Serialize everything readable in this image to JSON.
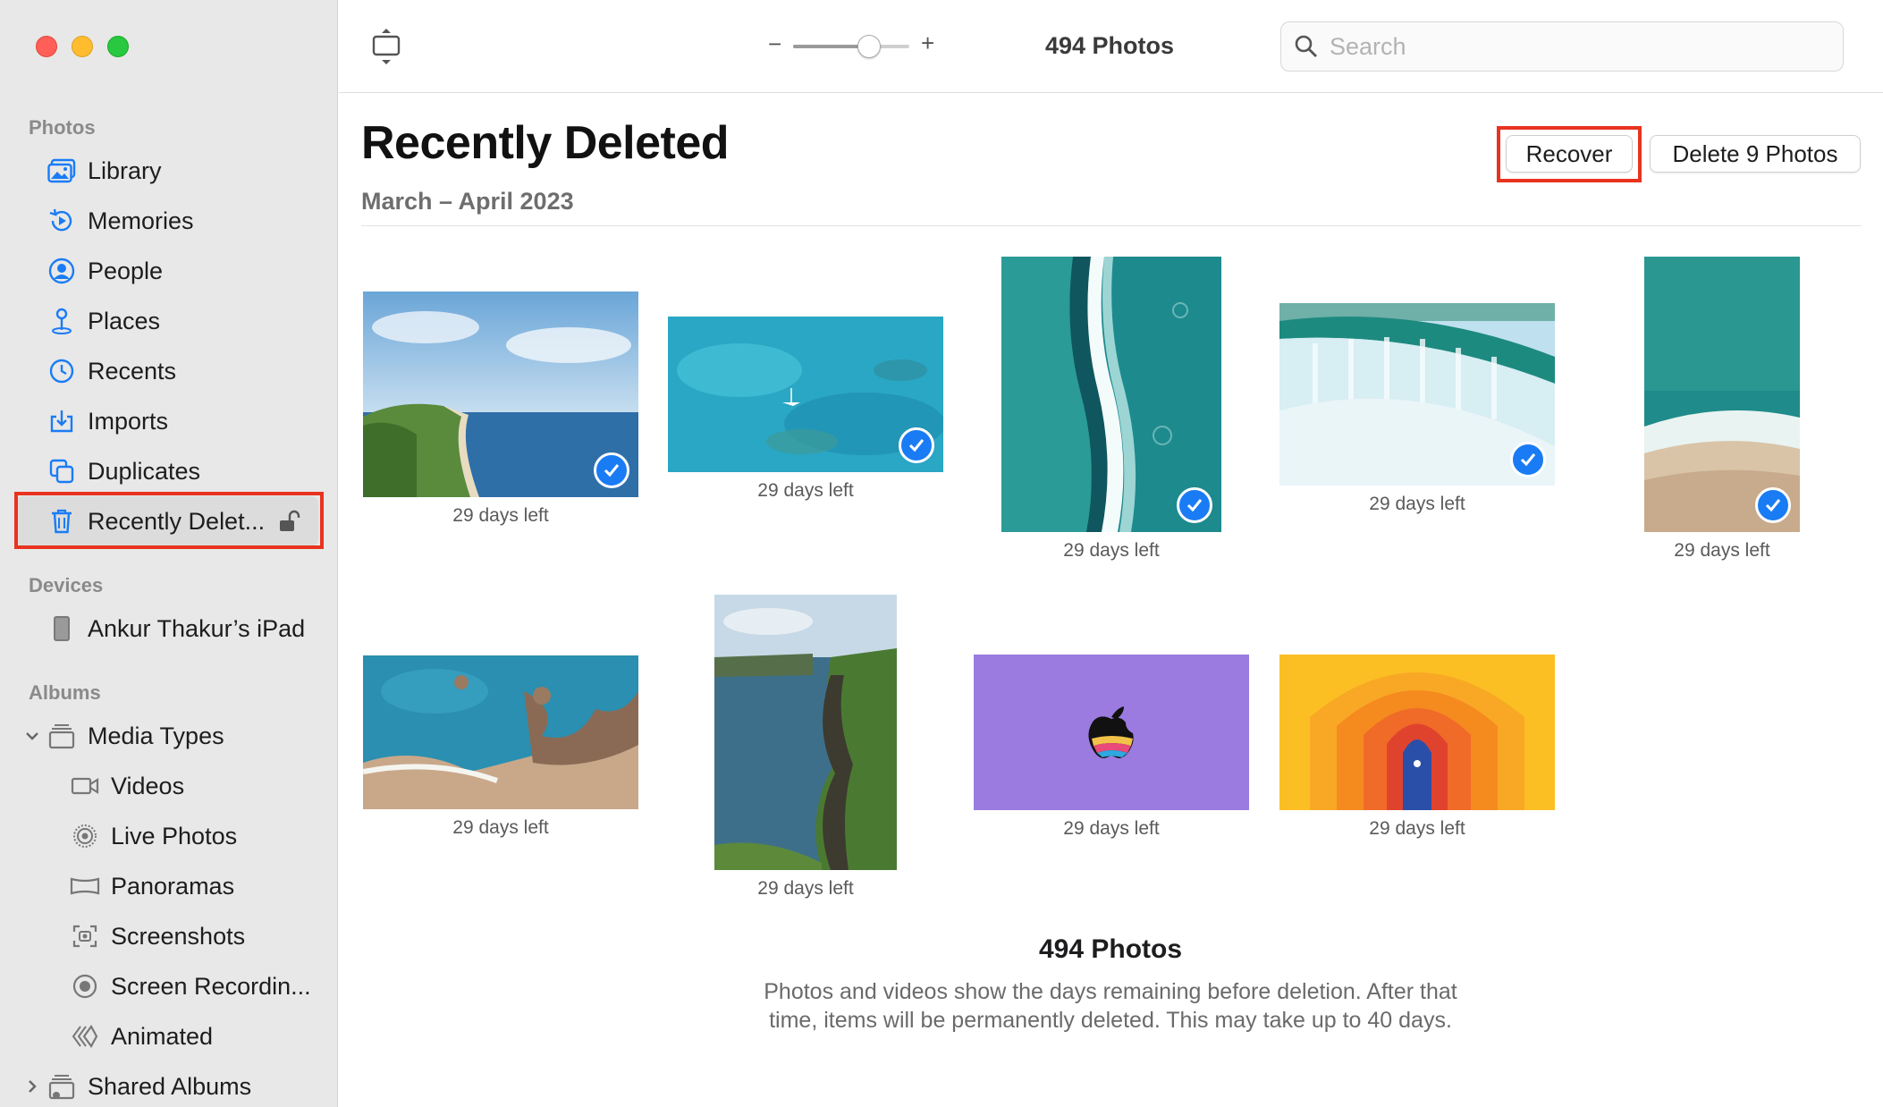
{
  "window": {
    "traffic_lights": [
      "close",
      "minimize",
      "zoom"
    ]
  },
  "sidebar": {
    "sections": {
      "photos": "Photos",
      "devices": "Devices",
      "albums": "Albums"
    },
    "photos_items": [
      {
        "label": "Library",
        "icon": "library-icon"
      },
      {
        "label": "Memories",
        "icon": "memories-icon"
      },
      {
        "label": "People",
        "icon": "people-icon"
      },
      {
        "label": "Places",
        "icon": "places-icon"
      },
      {
        "label": "Recents",
        "icon": "recents-icon"
      },
      {
        "label": "Imports",
        "icon": "imports-icon"
      },
      {
        "label": "Duplicates",
        "icon": "duplicates-icon"
      },
      {
        "label": "Recently Delet...",
        "icon": "trash-icon",
        "selected": true
      }
    ],
    "devices_items": [
      {
        "label": "Ankur Thakur’s iPad",
        "icon": "ipad-icon"
      }
    ],
    "albums_items": [
      {
        "label": "Media Types",
        "icon": "album-stack-icon",
        "expanded": true
      },
      {
        "label": "Videos",
        "icon": "video-icon"
      },
      {
        "label": "Live Photos",
        "icon": "live-photo-icon"
      },
      {
        "label": "Panoramas",
        "icon": "panorama-icon"
      },
      {
        "label": "Screenshots",
        "icon": "screenshot-icon"
      },
      {
        "label": "Screen Recordin...",
        "icon": "screen-recording-icon"
      },
      {
        "label": "Animated",
        "icon": "animated-icon"
      },
      {
        "label": "Shared Albums",
        "icon": "shared-albums-icon",
        "expanded": false
      }
    ]
  },
  "toolbar": {
    "title": "494 Photos",
    "zoom_minus": "−",
    "zoom_plus": "+",
    "zoom_level": 0.62,
    "search_placeholder": "Search"
  },
  "main": {
    "title": "Recently Deleted",
    "subtitle": "March – April 2023",
    "recover_label": "Recover",
    "delete_label": "Delete 9 Photos",
    "photos": [
      {
        "days_left": "29 days left",
        "selected": true
      },
      {
        "days_left": "29 days left",
        "selected": true
      },
      {
        "days_left": "29 days left",
        "selected": true
      },
      {
        "days_left": "29 days left",
        "selected": true
      },
      {
        "days_left": "29 days left",
        "selected": true
      },
      {
        "days_left": "29 days left",
        "selected": false
      },
      {
        "days_left": "29 days left",
        "selected": false
      },
      {
        "days_left": "29 days left",
        "selected": false
      },
      {
        "days_left": "29 days left",
        "selected": false
      }
    ],
    "footer_count": "494 Photos",
    "footer_desc": "Photos and videos show the days remaining before deletion. After that time, items will be permanently deleted. This may take up to 40 days."
  },
  "colors": {
    "accent": "#1a7cf5",
    "highlight": "#e8331f",
    "sidebar_bg": "#e8e8e8"
  }
}
